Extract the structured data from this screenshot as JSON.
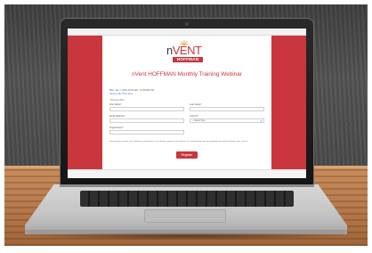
{
  "brand": {
    "name_part1": "n",
    "name_part2": "VENT",
    "sub_brand": "HOFFMAN",
    "accent_color": "#c9363e"
  },
  "event": {
    "title": "nVent HOFFMAN Monthly Training Webinar",
    "datetime": "Mon, Jan 7, 2019 10:00 AM - 11:00 AM CST",
    "calendar_link": "Show in My Time Zone"
  },
  "form": {
    "required_note": "* Required field",
    "fields": {
      "first_name_label": "First Name*",
      "last_name_label": "Last Name*",
      "email_label": "Email Address*",
      "country_label": "Country*",
      "country_value": "-- Select One --",
      "company_label": "Organization*"
    },
    "consent_text": "By clicking this button, you submit your information to the webinar organizer, who will use it to communicate with you regarding this event and their other services.",
    "register_label": "Register"
  }
}
